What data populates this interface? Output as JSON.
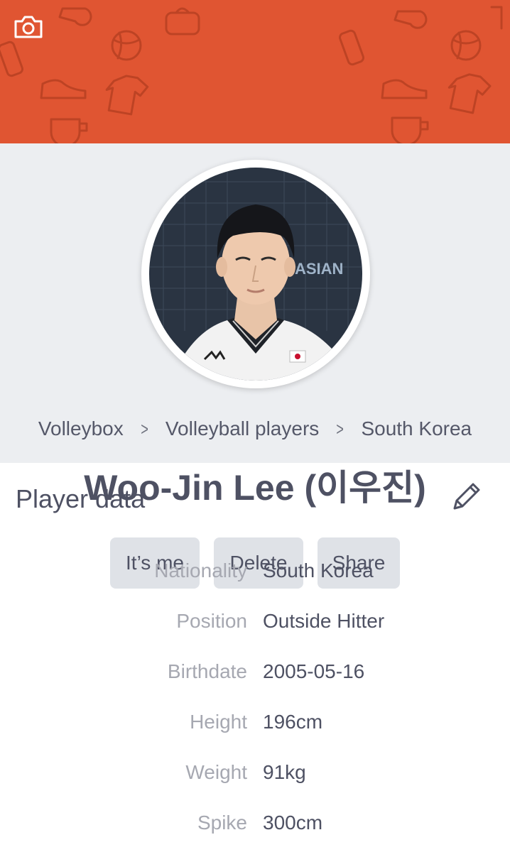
{
  "header": {
    "camera_icon": "camera-icon",
    "cover_color": "#e05532"
  },
  "profile": {
    "avatar": "player-photo",
    "breadcrumb": [
      "Volleybox",
      "Volleyball players",
      "South Korea"
    ],
    "name": "Woo-Jin Lee (이우진)"
  },
  "actions": {
    "its_me": "It’s me",
    "delete": "Delete",
    "share": "Share"
  },
  "player_data": {
    "title": "Player data",
    "edit_icon": "pencil-icon",
    "rows": [
      {
        "label": "Nationality",
        "value": "South Korea"
      },
      {
        "label": "Position",
        "value": "Outside Hitter"
      },
      {
        "label": "Birthdate",
        "value": "2005-05-16"
      },
      {
        "label": "Height",
        "value": "196cm"
      },
      {
        "label": "Weight",
        "value": "91kg"
      },
      {
        "label": "Spike",
        "value": "300cm"
      }
    ]
  }
}
